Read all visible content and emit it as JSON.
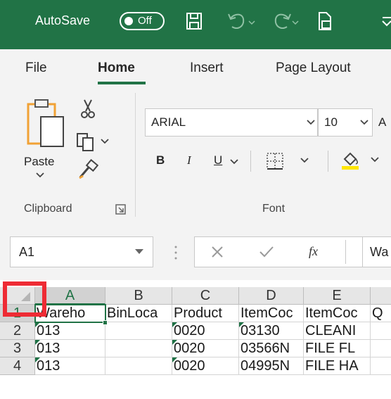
{
  "titlebar": {
    "autosave_label": "AutoSave",
    "autosave_state": "Off",
    "colors": {
      "bg": "#217346"
    },
    "icons": [
      "save-icon",
      "undo-icon",
      "redo-icon",
      "customize-qat-icon"
    ]
  },
  "tabs": [
    {
      "label": "File"
    },
    {
      "label": "Home",
      "selected": true
    },
    {
      "label": "Insert"
    },
    {
      "label": "Page Layout"
    }
  ],
  "ribbon": {
    "clipboard": {
      "paste_label": "Paste",
      "group_label": "Clipboard"
    },
    "font": {
      "font_name": "ARIAL",
      "font_size": "10",
      "bold": "B",
      "italic": "I",
      "underline": "U",
      "group_label": "Font"
    }
  },
  "formula_bar": {
    "name_box": "A1",
    "fx": "fx",
    "content": "Wa"
  },
  "grid": {
    "columns": [
      "A",
      "B",
      "C",
      "D",
      "E"
    ],
    "rows": [
      {
        "num": "1",
        "cells": [
          "Wareho",
          "BinLoca",
          "Product",
          "ItemCoc",
          "ItemCoc",
          "Q"
        ]
      },
      {
        "num": "2",
        "cells": [
          "013",
          "",
          "0020",
          "03130",
          "CLEANI",
          ""
        ]
      },
      {
        "num": "3",
        "cells": [
          "013",
          "",
          "0020",
          "03566N",
          "FILE FL",
          ""
        ]
      },
      {
        "num": "4",
        "cells": [
          "013",
          "",
          "0020",
          "04995N",
          "FILE HA",
          ""
        ]
      }
    ]
  }
}
